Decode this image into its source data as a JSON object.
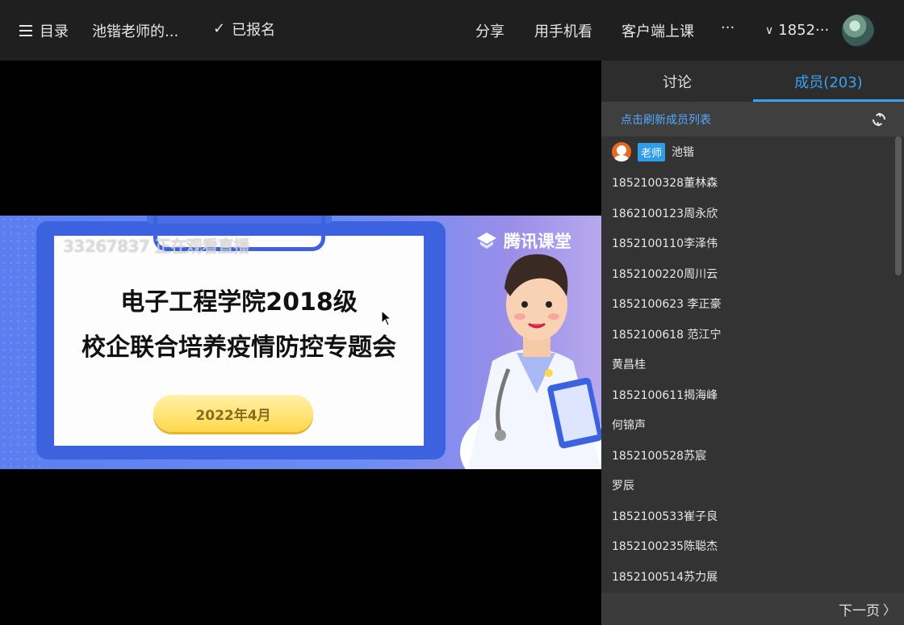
{
  "topbar": {
    "catalog_label": "目录",
    "course_title": "池锴老师的...",
    "registered_label": "已报名",
    "share_label": "分享",
    "mobile_label": "用手机看",
    "client_label": "客户端上课",
    "more_label": "···",
    "user_label": "1852···"
  },
  "slide": {
    "watermark": "33267837 正在观看直播",
    "brand": "腾讯课堂",
    "title_line1": "电子工程学院2018级",
    "title_line2": "校企联合培养疫情防控专题会",
    "date": "2022年4月"
  },
  "panel": {
    "tab_discuss": "讨论",
    "tab_members": "成员(203)",
    "refresh_label": "点击刷新成员列表",
    "teacher_badge": "老师",
    "teacher_name": "池锴",
    "members": [
      "1852100328董林森",
      "1862100123周永欣",
      "1852100110李泽伟",
      "1852100220周川云",
      "1852100623 李正豪",
      "1852100618 范江宁",
      "黄昌桂",
      "1852100611揭海峰",
      "何锦声",
      "1852100528苏宸",
      "罗辰",
      "1852100533崔子良",
      "1852100235陈聪杰",
      "1852100514苏力展"
    ],
    "next_page": "下一页"
  },
  "colors": {
    "accent": "#3aa0f0",
    "topbar_bg": "#1f1f1f",
    "panel_bg": "#333333"
  }
}
